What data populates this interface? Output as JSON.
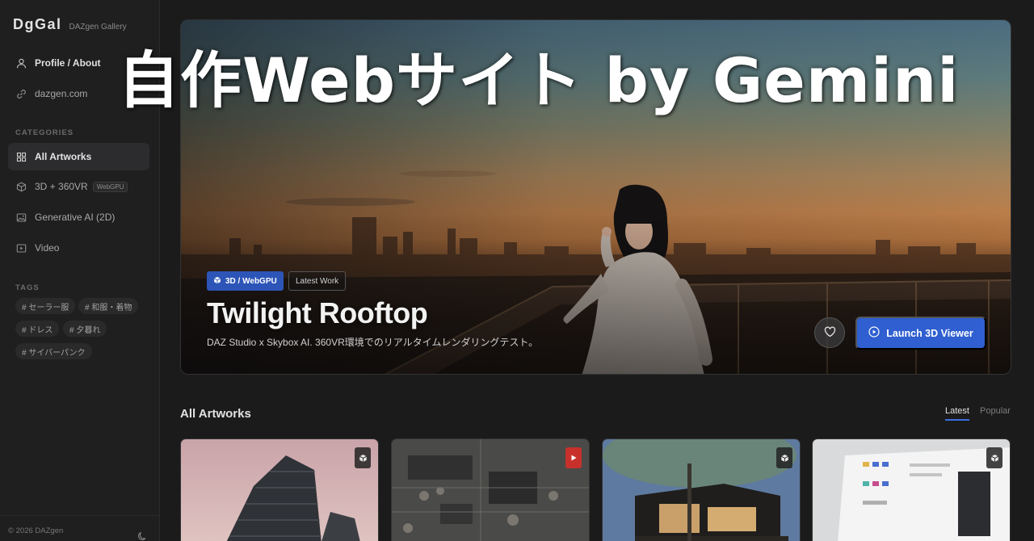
{
  "brand": {
    "logo": "DgGal",
    "subtitle": "DAZgen Gallery"
  },
  "sidebar": {
    "links": [
      {
        "label": "Profile / About",
        "icon": "user-icon"
      },
      {
        "label": "dazgen.com",
        "icon": "link-icon"
      }
    ],
    "categories_title": "CATEGORIES",
    "categories": [
      {
        "label": "All Artworks",
        "icon": "grid-icon",
        "active": true
      },
      {
        "label": "3D + 360VR",
        "icon": "cube-icon",
        "badge": "WebGPU"
      },
      {
        "label": "Generative AI (2D)",
        "icon": "image-icon"
      },
      {
        "label": "Video",
        "icon": "play-icon"
      }
    ],
    "tags_title": "TAGS",
    "tags": [
      "# セーラー服",
      "# 和服・着物",
      "# ドレス",
      "# 夕暮れ",
      "# サイバーパンク"
    ],
    "copyright": "© 2026 DAZgen"
  },
  "overlay_banner": "自作Webサイト by Gemini",
  "hero": {
    "badge_primary": "3D / WebGPU",
    "badge_secondary": "Latest Work",
    "title": "Twilight Rooftop",
    "description": "DAZ Studio x Skybox AI. 360VR環境でのリアルタイムレンダリングテスト。",
    "launch_label": "Launch 3D Viewer"
  },
  "gallery": {
    "heading": "All Artworks",
    "sort_tabs": [
      "Latest",
      "Popular"
    ],
    "active_sort": "Latest",
    "cards": [
      {
        "subject": "skyscraper",
        "type": "3d",
        "type_icon": "cube-icon"
      },
      {
        "subject": "circuit-board",
        "type": "video",
        "type_icon": "play-icon"
      },
      {
        "subject": "modern-house",
        "type": "3d",
        "type_icon": "cube-icon"
      },
      {
        "subject": "ui-design-screen",
        "type": "3d",
        "type_icon": "cube-icon"
      }
    ]
  },
  "colors": {
    "accent": "#2f5fd0",
    "background": "#1b1b1c",
    "sidebar": "#1f1f20",
    "video_badge": "#c8312b"
  }
}
